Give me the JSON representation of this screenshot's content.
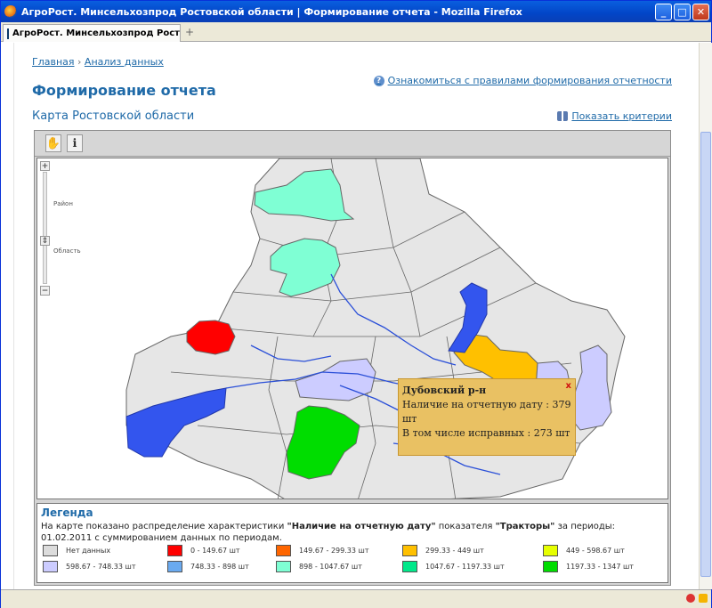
{
  "window": {
    "title": "АгроРост. Минсельхозпрод Ростовской области | Формирование отчета - Mozilla Firefox",
    "tab_label": "АгроРост. Минсельхозпрод Ростов...",
    "new_tab_label": "+",
    "min_label": "_",
    "max_label": "□",
    "close_label": "✕"
  },
  "breadcrumb": {
    "home": "Главная",
    "separator": "›",
    "current": "Анализ данных"
  },
  "page_title": "Формирование отчета",
  "rules_link": "Ознакомиться с правилами формирования отчетности",
  "map_title": "Карта Ростовской области",
  "criteria_link": "Показать критерии",
  "map": {
    "zoom_in": "+",
    "zoom_out": "−",
    "level_district": "Район",
    "level_region": "Область",
    "tool_pan": "✋",
    "tool_info": "ℹ"
  },
  "popup": {
    "title": "Дубовский р-н",
    "close": "x",
    "line1": "Наличие на отчетную дату : 379 шт",
    "line2": "В том числе исправных : 273 шт"
  },
  "legend": {
    "title": "Легенда",
    "desc_prefix": "На карте показано распределение характеристики",
    "characteristic": "\"Наличие на отчетную дату\"",
    "desc_mid": "показателя",
    "indicator": "\"Тракторы\"",
    "desc_suffix": "за периоды:",
    "desc_line2": "01.02.2011 с суммированием данных по периодам.",
    "items": [
      {
        "label": "Нет данных",
        "color": "#dcdcdc"
      },
      {
        "label": "0 - 149.67 шт",
        "color": "#ff0000"
      },
      {
        "label": "149.67 - 299.33 шт",
        "color": "#ff6600"
      },
      {
        "label": "299.33 - 449 шт",
        "color": "#ffc000"
      },
      {
        "label": "449 - 598.67 шт",
        "color": "#e6ff00"
      },
      {
        "label": "598.67 - 748.33 шт",
        "color": "#ccccff"
      },
      {
        "label": "748.33 - 898 шт",
        "color": "#6aaaf0"
      },
      {
        "label": "898 - 1047.67 шт",
        "color": "#7fffd4"
      },
      {
        "label": "1047.67 - 1197.33 шт",
        "color": "#00e88a"
      },
      {
        "label": "1197.33 - 1347 шт",
        "color": "#00dd00"
      }
    ]
  }
}
